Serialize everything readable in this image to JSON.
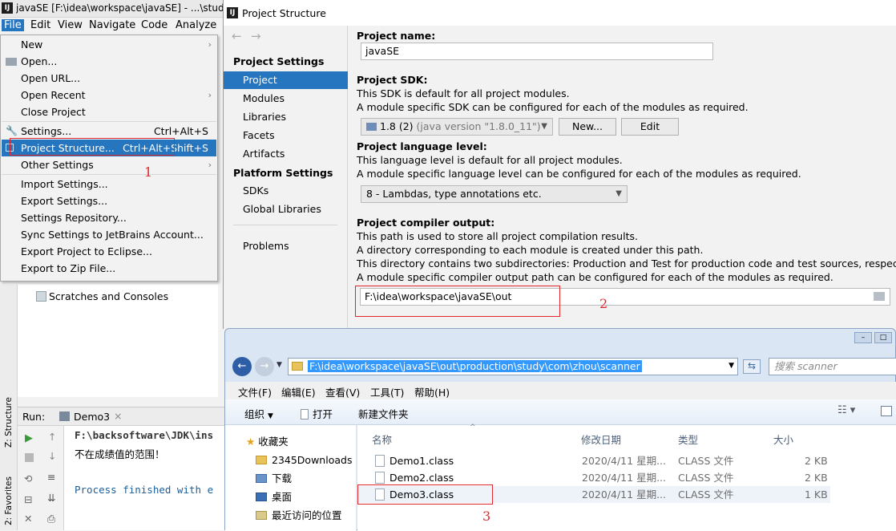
{
  "ide": {
    "title": "javaSE [F:\\idea\\workspace\\javaSE] - ...\\study\\",
    "menubar": [
      "File",
      "Edit",
      "View",
      "Navigate",
      "Code",
      "Analyze"
    ],
    "file_menu": [
      {
        "label": "New",
        "shortcut": "",
        "submenu": true
      },
      {
        "label": "Open...",
        "shortcut": ""
      },
      {
        "label": "Open URL...",
        "shortcut": ""
      },
      {
        "label": "Open Recent",
        "shortcut": "",
        "submenu": true
      },
      {
        "label": "Close Project",
        "shortcut": ""
      },
      {
        "label": "Settings...",
        "shortcut": "Ctrl+Alt+S"
      },
      {
        "label": "Project Structure...",
        "shortcut": "Ctrl+Alt+Shift+S"
      },
      {
        "label": "Other Settings",
        "shortcut": "",
        "submenu": true
      },
      {
        "label": "Import Settings...",
        "shortcut": ""
      },
      {
        "label": "Export Settings...",
        "shortcut": ""
      },
      {
        "label": "Settings Repository...",
        "shortcut": ""
      },
      {
        "label": "Sync Settings to JetBrains Account...",
        "shortcut": ""
      },
      {
        "label": "Export Project to Eclipse...",
        "shortcut": ""
      },
      {
        "label": "Export to Zip File...",
        "shortcut": ""
      }
    ],
    "tree_item": "Scratches and Consoles",
    "run_label": "Run:",
    "run_tab": "Demo3",
    "side_tabs": [
      "Z: Structure",
      "2: Favorites"
    ],
    "console_lines": [
      "F:\\backsoftware\\JDK\\ins",
      "不在成绩值的范围！",
      "",
      "Process finished with e"
    ]
  },
  "annotations": [
    "1",
    "2",
    "3"
  ],
  "project_structure": {
    "title": "Project Structure",
    "sections": {
      "project_settings": "Project Settings",
      "platform_settings": "Platform Settings"
    },
    "nav_project": [
      "Project",
      "Modules",
      "Libraries",
      "Facets",
      "Artifacts"
    ],
    "nav_platform": [
      "SDKs",
      "Global Libraries"
    ],
    "nav_problems": "Problems",
    "project_name_label": "Project name:",
    "project_name_value": "javaSE",
    "sdk_label": "Project SDK:",
    "sdk_desc1": "This SDK is default for all project modules.",
    "sdk_desc2": "A module specific SDK can be configured for each of the modules as required.",
    "sdk_value": "1.8 (2)",
    "sdk_version": "(java version \"1.8.0_11\")",
    "new_button": "New...",
    "edit_button": "Edit",
    "lang_label": "Project language level:",
    "lang_desc1": "This language level is default for all project modules.",
    "lang_desc2": "A module specific language level can be configured for each of the modules as required.",
    "lang_value": "8 - Lambdas, type annotations etc.",
    "output_label": "Project compiler output:",
    "output_desc1": "This path is used to store all project compilation results.",
    "output_desc2": "A directory corresponding to each module is created under this path.",
    "output_desc3": "This directory contains two subdirectories: Production and Test for production code and test sources, respectively.",
    "output_desc4": "A module specific compiler output path can be configured for each of the modules as required.",
    "output_value": "F:\\idea\\workspace\\javaSE\\out"
  },
  "explorer": {
    "address": "F:\\idea\\workspace\\javaSE\\out\\production\\study\\com\\zhou\\scanner",
    "search_placeholder": "搜索 scanner",
    "menu": [
      "文件(F)",
      "编辑(E)",
      "查看(V)",
      "工具(T)",
      "帮助(H)"
    ],
    "toolbar": {
      "organize": "组织",
      "open": "打开",
      "new_folder": "新建文件夹"
    },
    "nav": [
      "收藏夹",
      "2345Downloads",
      "下载",
      "桌面",
      "最近访问的位置"
    ],
    "columns": [
      "名称",
      "修改日期",
      "类型",
      "大小"
    ],
    "files": [
      {
        "name": "Demo1.class",
        "date": "2020/4/11 星期...",
        "type": "CLASS 文件",
        "size": "2 KB"
      },
      {
        "name": "Demo2.class",
        "date": "2020/4/11 星期...",
        "type": "CLASS 文件",
        "size": "2 KB"
      },
      {
        "name": "Demo3.class",
        "date": "2020/4/11 星期...",
        "type": "CLASS 文件",
        "size": "1 KB"
      }
    ]
  }
}
